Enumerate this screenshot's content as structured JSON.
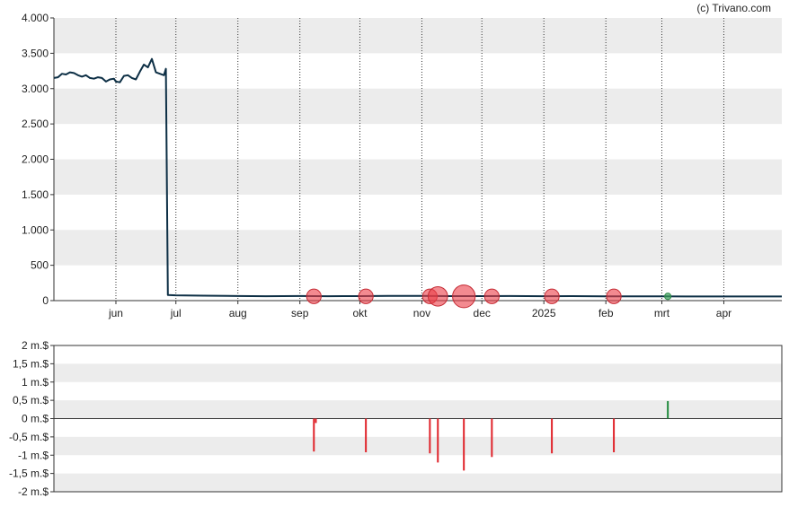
{
  "credit": "(c) Trivano.com",
  "chart_data": [
    {
      "type": "line",
      "title": "",
      "xlabel": "",
      "ylabel": "",
      "ylim": [
        0,
        4000
      ],
      "y_ticks": [
        {
          "value": 0,
          "label": "0"
        },
        {
          "value": 500,
          "label": "500"
        },
        {
          "value": 1000,
          "label": "1.000"
        },
        {
          "value": 1500,
          "label": "1.500"
        },
        {
          "value": 2000,
          "label": "2.000"
        },
        {
          "value": 2500,
          "label": "2.500"
        },
        {
          "value": 3000,
          "label": "3.000"
        },
        {
          "value": 3500,
          "label": "3.500"
        },
        {
          "value": 4000,
          "label": "4.000"
        }
      ],
      "xlim": [
        "2024-05-01",
        "2025-04-30"
      ],
      "x_ticks": [
        {
          "date": "2024-06-01",
          "label": "jun"
        },
        {
          "date": "2024-07-01",
          "label": "jul"
        },
        {
          "date": "2024-08-01",
          "label": "aug"
        },
        {
          "date": "2024-09-01",
          "label": "sep"
        },
        {
          "date": "2024-10-01",
          "label": "okt"
        },
        {
          "date": "2024-11-01",
          "label": "nov"
        },
        {
          "date": "2024-12-01",
          "label": "dec"
        },
        {
          "date": "2025-01-01",
          "label": "2025"
        },
        {
          "date": "2025-02-01",
          "label": "feb"
        },
        {
          "date": "2025-03-01",
          "label": "mrt"
        },
        {
          "date": "2025-04-01",
          "label": "apr"
        }
      ],
      "grid": "horizontal bands, vertical dotted lines at month ticks",
      "line_color": "#0d2f45",
      "series": [
        {
          "points": [
            [
              "2024-05-01",
              3150
            ],
            [
              "2024-05-03",
              3160
            ],
            [
              "2024-05-05",
              3210
            ],
            [
              "2024-05-07",
              3200
            ],
            [
              "2024-05-09",
              3230
            ],
            [
              "2024-05-11",
              3220
            ],
            [
              "2024-05-13",
              3190
            ],
            [
              "2024-05-15",
              3170
            ],
            [
              "2024-05-17",
              3190
            ],
            [
              "2024-05-19",
              3150
            ],
            [
              "2024-05-21",
              3140
            ],
            [
              "2024-05-23",
              3160
            ],
            [
              "2024-05-25",
              3150
            ],
            [
              "2024-05-27",
              3100
            ],
            [
              "2024-05-29",
              3130
            ],
            [
              "2024-05-31",
              3140
            ],
            [
              "2024-06-01",
              3100
            ],
            [
              "2024-06-03",
              3090
            ],
            [
              "2024-06-05",
              3180
            ],
            [
              "2024-06-07",
              3190
            ],
            [
              "2024-06-09",
              3150
            ],
            [
              "2024-06-11",
              3130
            ],
            [
              "2024-06-13",
              3240
            ],
            [
              "2024-06-15",
              3340
            ],
            [
              "2024-06-17",
              3300
            ],
            [
              "2024-06-19",
              3420
            ],
            [
              "2024-06-21",
              3230
            ],
            [
              "2024-06-23",
              3210
            ],
            [
              "2024-06-25",
              3190
            ],
            [
              "2024-06-26",
              3280
            ],
            [
              "2024-06-27",
              80
            ],
            [
              "2024-07-01",
              75
            ],
            [
              "2024-07-15",
              70
            ],
            [
              "2024-08-01",
              65
            ],
            [
              "2024-08-15",
              62
            ],
            [
              "2024-09-01",
              65
            ],
            [
              "2024-09-15",
              62
            ],
            [
              "2024-10-01",
              64
            ],
            [
              "2024-10-15",
              66
            ],
            [
              "2024-11-01",
              67
            ],
            [
              "2024-11-15",
              64
            ],
            [
              "2024-12-01",
              63
            ],
            [
              "2024-12-15",
              65
            ],
            [
              "2025-01-01",
              62
            ],
            [
              "2025-01-15",
              63
            ],
            [
              "2025-02-01",
              60
            ],
            [
              "2025-02-15",
              61
            ],
            [
              "2025-03-01",
              60
            ],
            [
              "2025-03-15",
              59
            ],
            [
              "2025-04-01",
              58
            ],
            [
              "2025-04-15",
              58
            ],
            [
              "2025-04-30",
              59
            ]
          ]
        }
      ],
      "markers": [
        {
          "date": "2024-09-08",
          "value": 60,
          "size": 0.9,
          "color": "red"
        },
        {
          "date": "2024-10-04",
          "value": 60,
          "size": 0.9,
          "color": "red"
        },
        {
          "date": "2024-11-05",
          "value": 60,
          "size": 0.9,
          "color": "red"
        },
        {
          "date": "2024-11-09",
          "value": 60,
          "size": 1.2,
          "color": "red"
        },
        {
          "date": "2024-11-22",
          "value": 60,
          "size": 1.4,
          "color": "red"
        },
        {
          "date": "2024-12-06",
          "value": 60,
          "size": 0.9,
          "color": "red"
        },
        {
          "date": "2025-01-05",
          "value": 60,
          "size": 0.9,
          "color": "red"
        },
        {
          "date": "2025-02-05",
          "value": 60,
          "size": 0.9,
          "color": "red"
        },
        {
          "date": "2025-03-04",
          "value": 60,
          "size": 0.4,
          "color": "green"
        }
      ]
    },
    {
      "type": "bar",
      "title": "",
      "xlabel": "",
      "ylabel": "",
      "ylim": [
        -2,
        2
      ],
      "y_ticks": [
        {
          "value": 2,
          "label": "2 m.$"
        },
        {
          "value": 1.5,
          "label": "1,5 m.$"
        },
        {
          "value": 1,
          "label": "1 m.$"
        },
        {
          "value": 0.5,
          "label": "0,5 m.$"
        },
        {
          "value": 0,
          "label": "0 m.$"
        },
        {
          "value": -0.5,
          "label": "-0,5 m.$"
        },
        {
          "value": -1,
          "label": "-1 m.$"
        },
        {
          "value": -1.5,
          "label": "-1,5 m.$"
        },
        {
          "value": -2,
          "label": "-2 m.$"
        }
      ],
      "xlim": [
        "2024-05-01",
        "2025-04-30"
      ],
      "grid": "horizontal bands",
      "colors": {
        "negative": "#e0242b",
        "positive": "#1f8a3b"
      },
      "bars": [
        {
          "date": "2024-09-08",
          "value": -0.9
        },
        {
          "date": "2024-09-09",
          "value": -0.12
        },
        {
          "date": "2024-10-04",
          "value": -0.92
        },
        {
          "date": "2024-11-05",
          "value": -0.95
        },
        {
          "date": "2024-11-09",
          "value": -1.2
        },
        {
          "date": "2024-11-22",
          "value": -1.42
        },
        {
          "date": "2024-12-06",
          "value": -1.05
        },
        {
          "date": "2025-01-05",
          "value": -0.95
        },
        {
          "date": "2025-02-05",
          "value": -0.92
        },
        {
          "date": "2025-03-04",
          "value": 0.48
        }
      ]
    }
  ]
}
